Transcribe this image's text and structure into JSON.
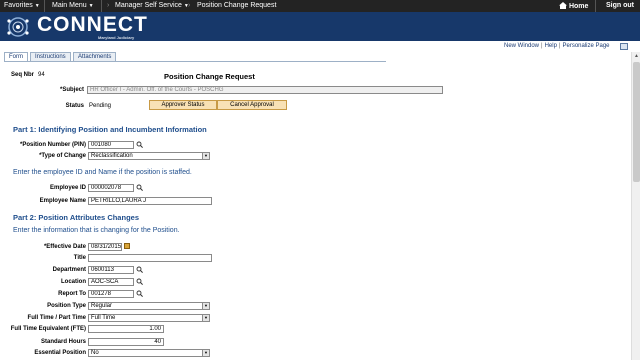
{
  "topnav": {
    "favorites": "Favorites",
    "main_menu": "Main Menu",
    "breadcrumb_1": "Manager Self Service",
    "breadcrumb_2": "Position Change Request",
    "home": "Home",
    "sign_out": "Sign out"
  },
  "banner": {
    "logo_text": "CONNECT",
    "logo_sub": "Maryland Judiciary"
  },
  "tabs": [
    {
      "label": "Form",
      "active": true
    },
    {
      "label": "Instructions",
      "active": false
    },
    {
      "label": "Attachments",
      "active": false
    }
  ],
  "pagelinks": {
    "new_window": "New Window",
    "help": "Help",
    "personalize": "Personalize Page",
    "sep": "|"
  },
  "header": {
    "seq_label": "Seq Nbr",
    "seq_value": "94",
    "title": "Position Change Request",
    "subject_label": "*Subject",
    "subject_value": "HR Officer I - Admin. Off. of the Courts - POSCHG",
    "status_label": "Status",
    "status_value": "Pending",
    "approver_status_btn": "Approver Status",
    "cancel_approval_btn": "Cancel Approval"
  },
  "part1": {
    "heading": "Part 1: Identifying Position and Incumbent Information",
    "pin_label": "*Position Number (PIN)",
    "pin_value": "001080",
    "type_change_label": "*Type of Change",
    "type_change_value": "Reclassification",
    "instruction": "Enter the employee ID and Name if the position is staffed.",
    "emplid_label": "Employee ID",
    "emplid_value": "000002078",
    "empname_label": "Employee Name",
    "empname_value": "PETRILLO,LAURA J"
  },
  "part2": {
    "heading": "Part 2: Position Attributes Changes",
    "instruction": "Enter the information that is changing for the Position.",
    "effdt_label": "*Effective Date",
    "effdt_value": "08/31/2015",
    "title_label": "Title",
    "title_value": "",
    "dept_label": "Department",
    "dept_value": "0600113",
    "location_label": "Location",
    "location_value": "AOC-SCA",
    "reportsto_label": "Report To",
    "reportsto_value": "001278",
    "postype_label": "Position Type",
    "postype_value": "Regular",
    "ftpt_label": "Full Time / Part Time",
    "ftpt_value": "Full Time",
    "fte_label": "Full Time Equivalent (FTE)",
    "fte_value": "1.00",
    "stdhrs_label": "Standard Hours",
    "stdhrs_value": "40",
    "essential_label": "Essential Position",
    "essential_value": "No"
  },
  "colors": {
    "topnav": "#232323",
    "banner": "#17386a",
    "section": "#1f4e8c",
    "button": "#f8e1b5"
  },
  "icons": [
    "home-icon",
    "lookup-icon",
    "calendar-icon",
    "grid-icon",
    "dropdown-icon"
  ]
}
